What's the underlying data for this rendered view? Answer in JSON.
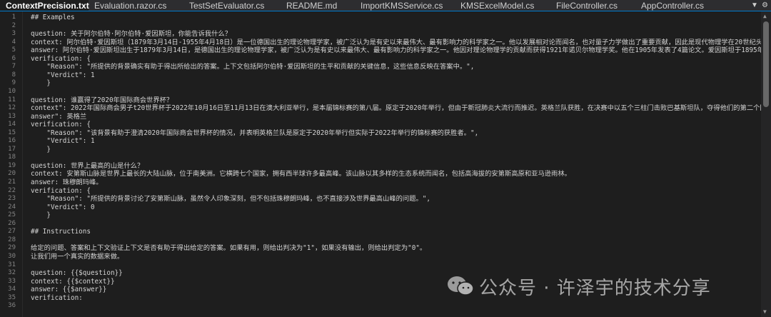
{
  "tabs": [
    {
      "label": "ContextPrecision.txt",
      "active": true
    },
    {
      "label": "Evaluation.razor.cs",
      "active": false
    },
    {
      "label": "TestSetEvaluator.cs",
      "active": false
    },
    {
      "label": "README.md",
      "active": false
    },
    {
      "label": "ImportKMSService.cs",
      "active": false
    },
    {
      "label": "KMSExcelModel.cs",
      "active": false
    },
    {
      "label": "FileController.cs",
      "active": false
    },
    {
      "label": "AppController.cs",
      "active": false
    }
  ],
  "tab_tools": {
    "dropdown_icon": "chevron-down-icon",
    "settings_icon": "gear-icon"
  },
  "editor": {
    "lines": [
      {
        "n": "1",
        "text": "## Examples"
      },
      {
        "n": "2",
        "text": ""
      },
      {
        "n": "3",
        "text": "question: 关于阿尔伯特·阿尔伯特·爱因斯坦，你能告诉我什么？"
      },
      {
        "n": "4",
        "text": "context: 阿尔伯特·爱因斯坦（1879年3月14日-1955年4月18日）是一位德国出生的理论物理学家，被广泛认为是有史以来最伟大、最有影响力的科学家之一。他以发展相对论而闻名，也对量子力学做出了重要贡献，因此是现代物理学在20世纪头"
      },
      {
        "n": "5",
        "text": "answer: 阿尔伯特·爱因斯坦出生于1879年3月14日，是德国出生的理论物理学家，被广泛认为是有史以来最伟大、最有影响力的科学家之一。他因对理论物理学的贡献而获得1921年诺贝尔物理学奖。他在1905年发表了4篇论文。爱因斯坦于1895年"
      },
      {
        "n": "6",
        "text": "verification: {"
      },
      {
        "n": "7",
        "text": "    \"Reason\": \"所提供的背景确实有助于得出所给出的答案。上下文包括阿尔伯特·爱因斯坦的生平和贡献的关键信息，这些信息反映在答案中。\","
      },
      {
        "n": "8",
        "text": "    \"Verdict\": 1"
      },
      {
        "n": "9",
        "text": "    }"
      },
      {
        "n": "10",
        "text": ""
      },
      {
        "n": "11",
        "text": "question: 谁赢得了2020年国际商会世界杯？"
      },
      {
        "n": "12",
        "text": "context\": 2022年国际商会男子t20世界杯于2022年10月16日至11月13日在澳大利亚举行，是本届锦标赛的第八届。原定于2020年举行，但由于新冠肺炎大流行而推迟。英格兰队获胜，在决赛中以五个三柱门击败巴基斯坦队，夺得他们的第二个国"
      },
      {
        "n": "13",
        "text": "answer\": 英格兰"
      },
      {
        "n": "14",
        "text": "verification: {"
      },
      {
        "n": "15",
        "text": "    \"Reason\": \"该背景有助于澄清2020年国际商会世界杯的情况，并表明英格兰队是原定于2020年举行但实际于2022年举行的锦标赛的获胜者。\","
      },
      {
        "n": "16",
        "text": "    \"Verdict\": 1"
      },
      {
        "n": "17",
        "text": "    }"
      },
      {
        "n": "18",
        "text": ""
      },
      {
        "n": "19",
        "text": "question: 世界上最高的山是什么？"
      },
      {
        "n": "20",
        "text": "context: 安第斯山脉是世界上最长的大陆山脉，位于南美洲。它横跨七个国家，拥有西半球许多最高峰。该山脉以其多样的生态系统而闻名，包括高海拔的安第斯高原和亚马逊雨林。"
      },
      {
        "n": "21",
        "text": "answer: 珠穆朗玛峰。"
      },
      {
        "n": "22",
        "text": "verification: {"
      },
      {
        "n": "23",
        "text": "    \"Reason\": \"所提供的背景讨论了安第斯山脉，虽然令人印象深刻，但不包括珠穆朗玛峰，也不直接涉及世界最高山峰的问题。\","
      },
      {
        "n": "24",
        "text": "    \"Verdict\": 0"
      },
      {
        "n": "25",
        "text": "    }"
      },
      {
        "n": "26",
        "text": ""
      },
      {
        "n": "27",
        "text": "## Instructions"
      },
      {
        "n": "28",
        "text": ""
      },
      {
        "n": "29",
        "text": "给定的问题、答案和上下文验证上下文是否有助于得出给定的答案。如果有用，则给出判决为\"1\"，如果没有输出，则给出判定为\"0\"。"
      },
      {
        "n": "30",
        "text": "让我们用一个真实的数据来做。"
      },
      {
        "n": "31",
        "text": ""
      },
      {
        "n": "32",
        "text": "question: {{$question}}"
      },
      {
        "n": "33",
        "text": "context: {{$context}}"
      },
      {
        "n": "34",
        "text": "answer: {{$answer}}"
      },
      {
        "n": "35",
        "text": "verification:"
      },
      {
        "n": "36",
        "text": ""
      }
    ]
  },
  "watermark": {
    "icon": "wechat-icon",
    "text": "公众号 · 许泽宇的技术分享"
  }
}
